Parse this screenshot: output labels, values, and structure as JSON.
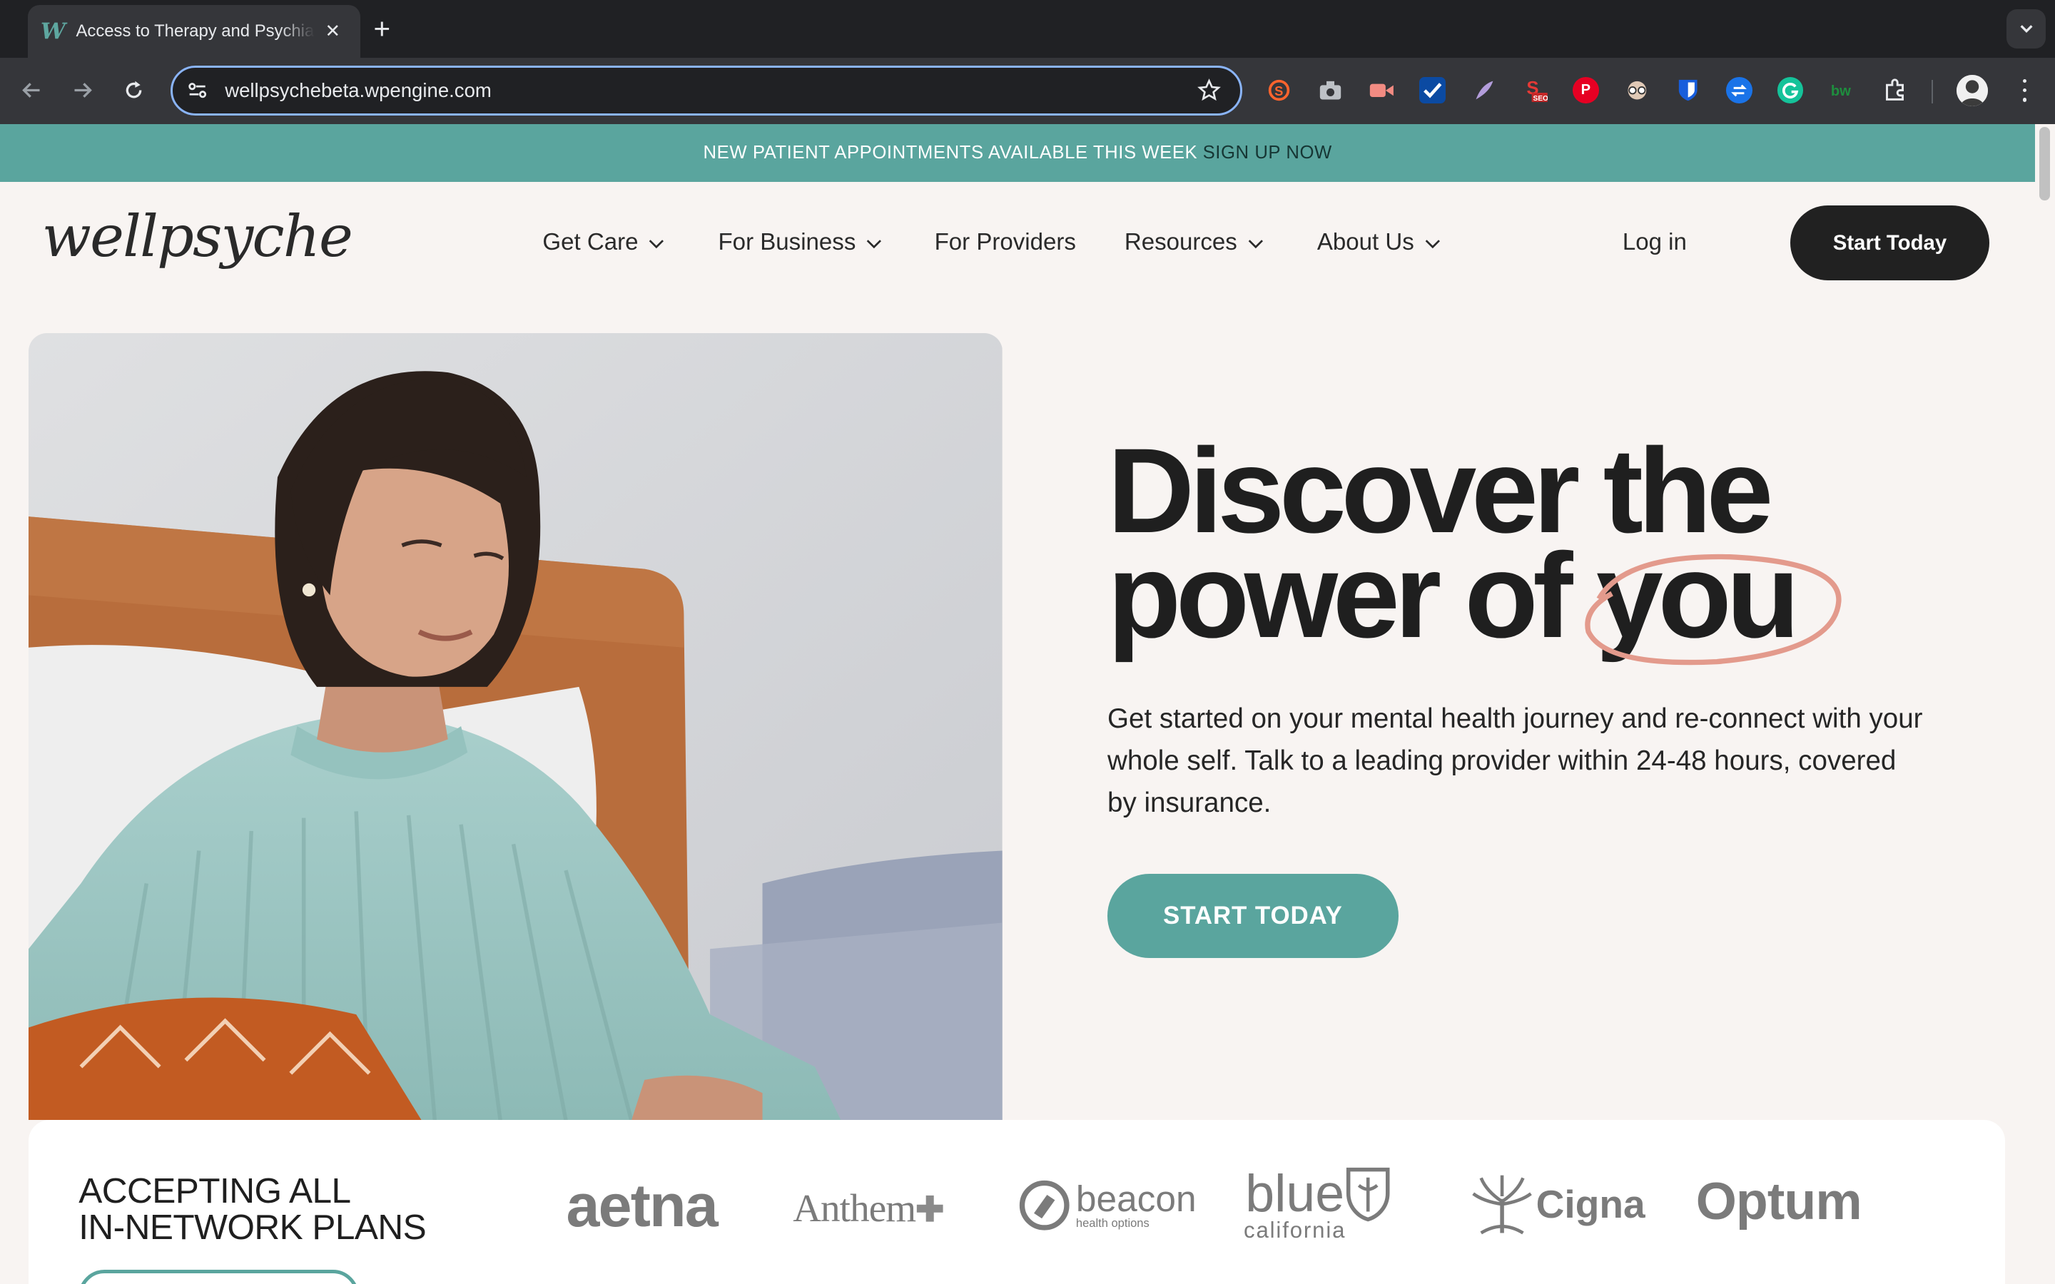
{
  "browser": {
    "tab_title": "Access to Therapy and Psychiatry",
    "url": "wellpsychebeta.wpengine.com",
    "extensions": [
      "semrush-icon",
      "camera-icon",
      "video-icon",
      "check-icon",
      "feather-icon",
      "seo-icon",
      "pinterest-icon",
      "glasses-icon",
      "bitwarden-icon",
      "translate-icon",
      "grammarly-icon",
      "tag-icon",
      "puzzle-icon"
    ]
  },
  "promo": {
    "text": "NEW PATIENT APPOINTMENTS AVAILABLE THIS WEEK",
    "link": "SIGN UP NOW"
  },
  "header": {
    "logo": "wellpsyche",
    "nav": [
      {
        "label": "Get Care",
        "dropdown": true
      },
      {
        "label": "For Business",
        "dropdown": true
      },
      {
        "label": "For Providers",
        "dropdown": false
      },
      {
        "label": "Resources",
        "dropdown": true
      },
      {
        "label": "About Us",
        "dropdown": true
      }
    ],
    "login": "Log in",
    "cta": "Start Today"
  },
  "hero": {
    "headline_line1": "Discover the",
    "headline_line2_start": "power of",
    "headline_highlight": "you",
    "subtext": "Get started on your mental health journey and re-connect with your whole self. Talk to a leading provider within 24-48 hours, covered by insurance.",
    "cta": "START TODAY"
  },
  "plans": {
    "title_line1": "ACCEPTING ALL",
    "title_line2": "IN-NETWORK PLANS",
    "logos": {
      "aetna": "aetna",
      "anthem": "Anthem",
      "beacon": "beacon",
      "beacon_sub": "health options",
      "blue": "blue",
      "blue_sub": "california",
      "cigna": "Cigna",
      "optum": "Optum"
    }
  },
  "colors": {
    "brand_teal": "#5aa59e",
    "dark": "#212121",
    "accent_circle": "#e39a8c"
  }
}
